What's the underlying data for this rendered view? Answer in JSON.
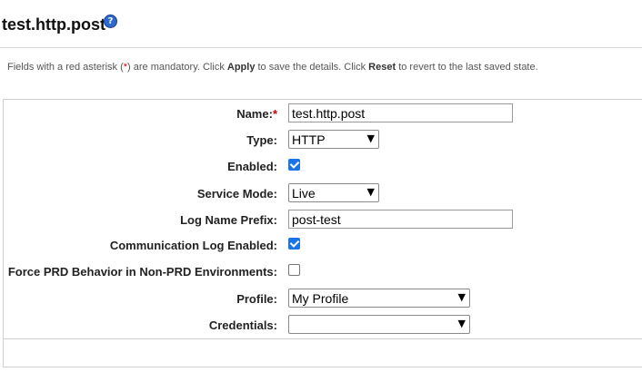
{
  "header": {
    "title": "test.http.post",
    "help_icon_glyph": "?"
  },
  "instructions": {
    "part1": "Fields with a red asterisk (",
    "asterisk": "*",
    "part2": ") are mandatory. Click ",
    "apply": "Apply",
    "part3": " to save the details. Click ",
    "reset": "Reset",
    "part4": " to revert to the last saved state."
  },
  "form": {
    "required_mark": "*",
    "name": {
      "label": "Name:",
      "value": "test.http.post"
    },
    "type": {
      "label": "Type:",
      "value": "HTTP"
    },
    "enabled": {
      "label": "Enabled:",
      "checked": true
    },
    "service_mode": {
      "label": "Service Mode:",
      "value": "Live"
    },
    "log_name_prefix": {
      "label": "Log Name Prefix:",
      "value": "post-test"
    },
    "comm_log_enabled": {
      "label": "Communication Log Enabled:",
      "checked": true
    },
    "force_prd": {
      "label": "Force PRD Behavior in Non-PRD Environments:",
      "checked": false
    },
    "profile": {
      "label": "Profile:",
      "value": "My Profile"
    },
    "credentials": {
      "label": "Credentials:",
      "value": ""
    }
  },
  "colors": {
    "checkbox_checked": "#1a73e8",
    "required_red": "#cc0000",
    "help_icon_blue": "#2c6bd0"
  }
}
